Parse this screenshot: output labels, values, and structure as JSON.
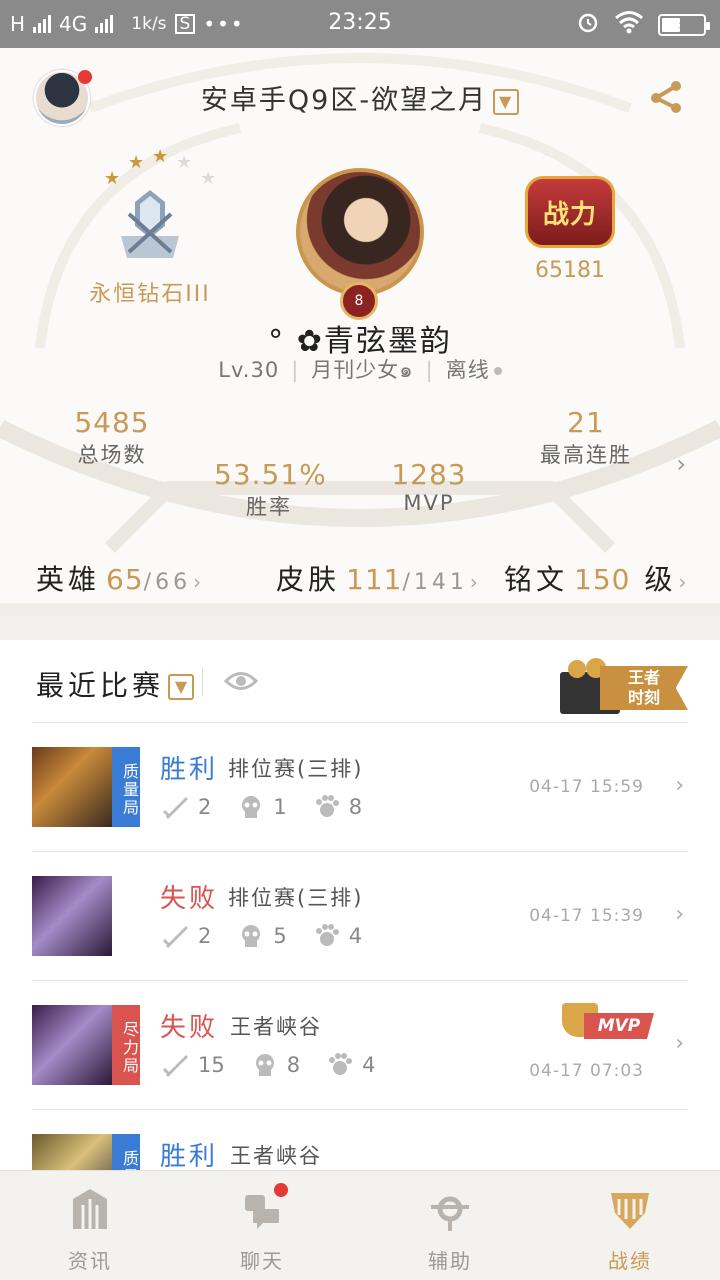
{
  "status_bar": {
    "signal1": "H",
    "network": "4G",
    "speed": "1k/s",
    "time": "23:25"
  },
  "header": {
    "server": "安卓手Q9区-欲望之月",
    "dropdown_icon": "chevron-down-icon",
    "share_icon": "share-icon"
  },
  "profile": {
    "rank_stars": 5,
    "rank_name": "永恒钻石III",
    "power_label": "战力",
    "power_value": "65181",
    "level_badge": "8",
    "player_name": "° ✿青弦墨韵",
    "level": "Lv.30",
    "title": "月刊少女๑",
    "status": "离线"
  },
  "stats": {
    "total_games": {
      "value": "5485",
      "label": "总场数"
    },
    "win_rate": {
      "value": "53.51%",
      "label": "胜率"
    },
    "mvp": {
      "value": "1283",
      "label": "MVP"
    },
    "max_streak": {
      "value": "21",
      "label": "最高连胜"
    }
  },
  "counts": {
    "heroes": {
      "label": "英雄",
      "owned": "65",
      "total": "66"
    },
    "skins": {
      "label": "皮肤",
      "owned": "111",
      "total": "141"
    },
    "runes": {
      "label": "铭文",
      "value": "150",
      "unit": "级"
    }
  },
  "matches": {
    "title": "最近比赛",
    "moment_label_1": "王者",
    "moment_label_2": "时刻",
    "items": [
      {
        "result": "胜利",
        "mode": "排位赛(三排)",
        "tag": "质量局",
        "kills": "2",
        "deaths": "1",
        "assists": "8",
        "time": "04-17 15:59"
      },
      {
        "result": "失败",
        "mode": "排位赛(三排)",
        "tag": "",
        "kills": "2",
        "deaths": "5",
        "assists": "4",
        "time": "04-17 15:39"
      },
      {
        "result": "失败",
        "mode": "王者峡谷",
        "tag": "尽力局",
        "kills": "15",
        "deaths": "8",
        "assists": "4",
        "time": "04-17 07:03",
        "badge": "MVP"
      },
      {
        "result": "胜利",
        "mode": "王者峡谷",
        "tag": "质量局"
      }
    ]
  },
  "nav": [
    {
      "label": "资讯",
      "icon": "news-icon"
    },
    {
      "label": "聊天",
      "icon": "chat-icon"
    },
    {
      "label": "辅助",
      "icon": "assist-icon"
    },
    {
      "label": "战绩",
      "icon": "record-icon"
    }
  ],
  "colors": {
    "accent": "#c89a55",
    "win": "#3a7bd5",
    "lose": "#d9534f"
  }
}
